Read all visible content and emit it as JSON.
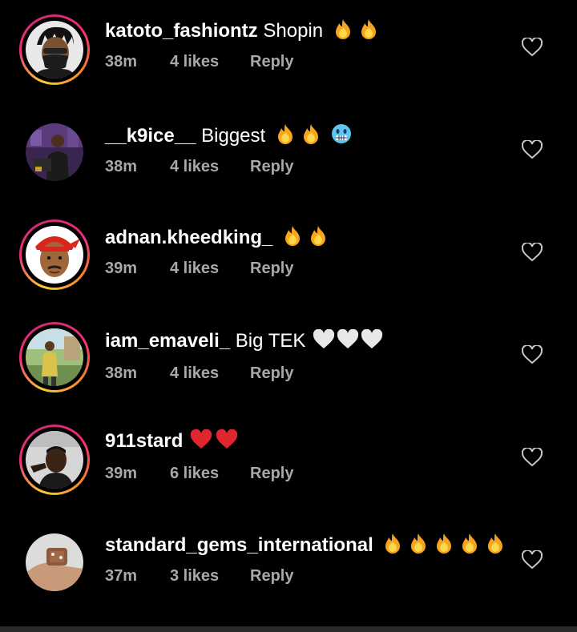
{
  "comments": [
    {
      "username": "katoto_fashiontz",
      "text": "Shopin",
      "emojis": [
        "fire",
        "fire"
      ],
      "time": "38m",
      "likes": "4 likes",
      "reply": "Reply",
      "story_ring": true,
      "avatar": "masked-person"
    },
    {
      "username": "__k9ice__",
      "text": "Biggest",
      "emojis": [
        "fire",
        "fire",
        "cold-face"
      ],
      "time": "38m",
      "likes": "4 likes",
      "reply": "Reply",
      "story_ring": false,
      "avatar": "person-purple-scene"
    },
    {
      "username": "adnan.kheedking_",
      "text": "",
      "emojis": [
        "fire",
        "fire"
      ],
      "time": "39m",
      "likes": "4 likes",
      "reply": "Reply",
      "story_ring": true,
      "avatar": "cartoon-bandana-man"
    },
    {
      "username": "iam_emaveli_",
      "text": "Big TEK",
      "emojis": [
        "white-heart",
        "white-heart",
        "white-heart"
      ],
      "time": "38m",
      "likes": "4 likes",
      "reply": "Reply",
      "story_ring": true,
      "avatar": "person-outdoors"
    },
    {
      "username": "911stard",
      "text": "",
      "emojis": [
        "red-heart",
        "red-heart"
      ],
      "time": "39m",
      "likes": "6 likes",
      "reply": "Reply",
      "story_ring": true,
      "avatar": "person-selfie"
    },
    {
      "username": "standard_gems_international",
      "text": "",
      "emojis": [
        "fire",
        "fire",
        "fire",
        "fire",
        "fire"
      ],
      "time": "37m",
      "likes": "3 likes",
      "reply": "Reply",
      "story_ring": false,
      "avatar": "gem-in-hand"
    }
  ],
  "colors": {
    "background": "#000000",
    "meta": "#a8a8a8",
    "ring_start": "#f9ce34",
    "ring_end": "#ee2a7b"
  }
}
